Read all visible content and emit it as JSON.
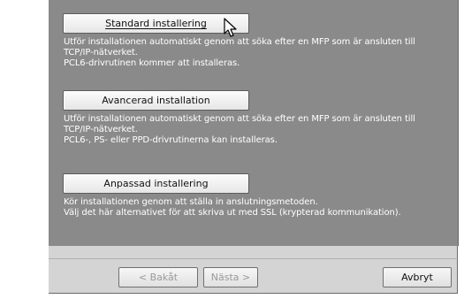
{
  "options": [
    {
      "label": "Standard installering",
      "description": [
        "Utför installationen automatiskt genom att söka efter en MFP som är ansluten till",
        "TCP/IP-nätverket.",
        "PCL6-drivrutinen kommer att installeras."
      ]
    },
    {
      "label": "Avancerad installation",
      "description": [
        "Utför installationen automatiskt genom att söka efter en MFP som är ansluten till",
        "TCP/IP-nätverket.",
        "PCL6-, PS- eller PPD-drivrutinerna kan installeras."
      ]
    },
    {
      "label": "Anpassad installering",
      "description": [
        "Kör installationen genom att ställa in anslutningsmetoden.",
        "Välj det här alternativet för att skriva ut med SSL (krypterad kommunikation)."
      ]
    }
  ],
  "nav": {
    "back_label": "< Bakåt",
    "next_label": "Nästa >",
    "cancel_label": "Avbryt"
  },
  "colors": {
    "panel_bg": "#8a8a8a",
    "bar_bg": "#d4d4d4",
    "description_text": "#ffffff"
  },
  "icons": {
    "cursor": "mouse-pointer-icon"
  }
}
